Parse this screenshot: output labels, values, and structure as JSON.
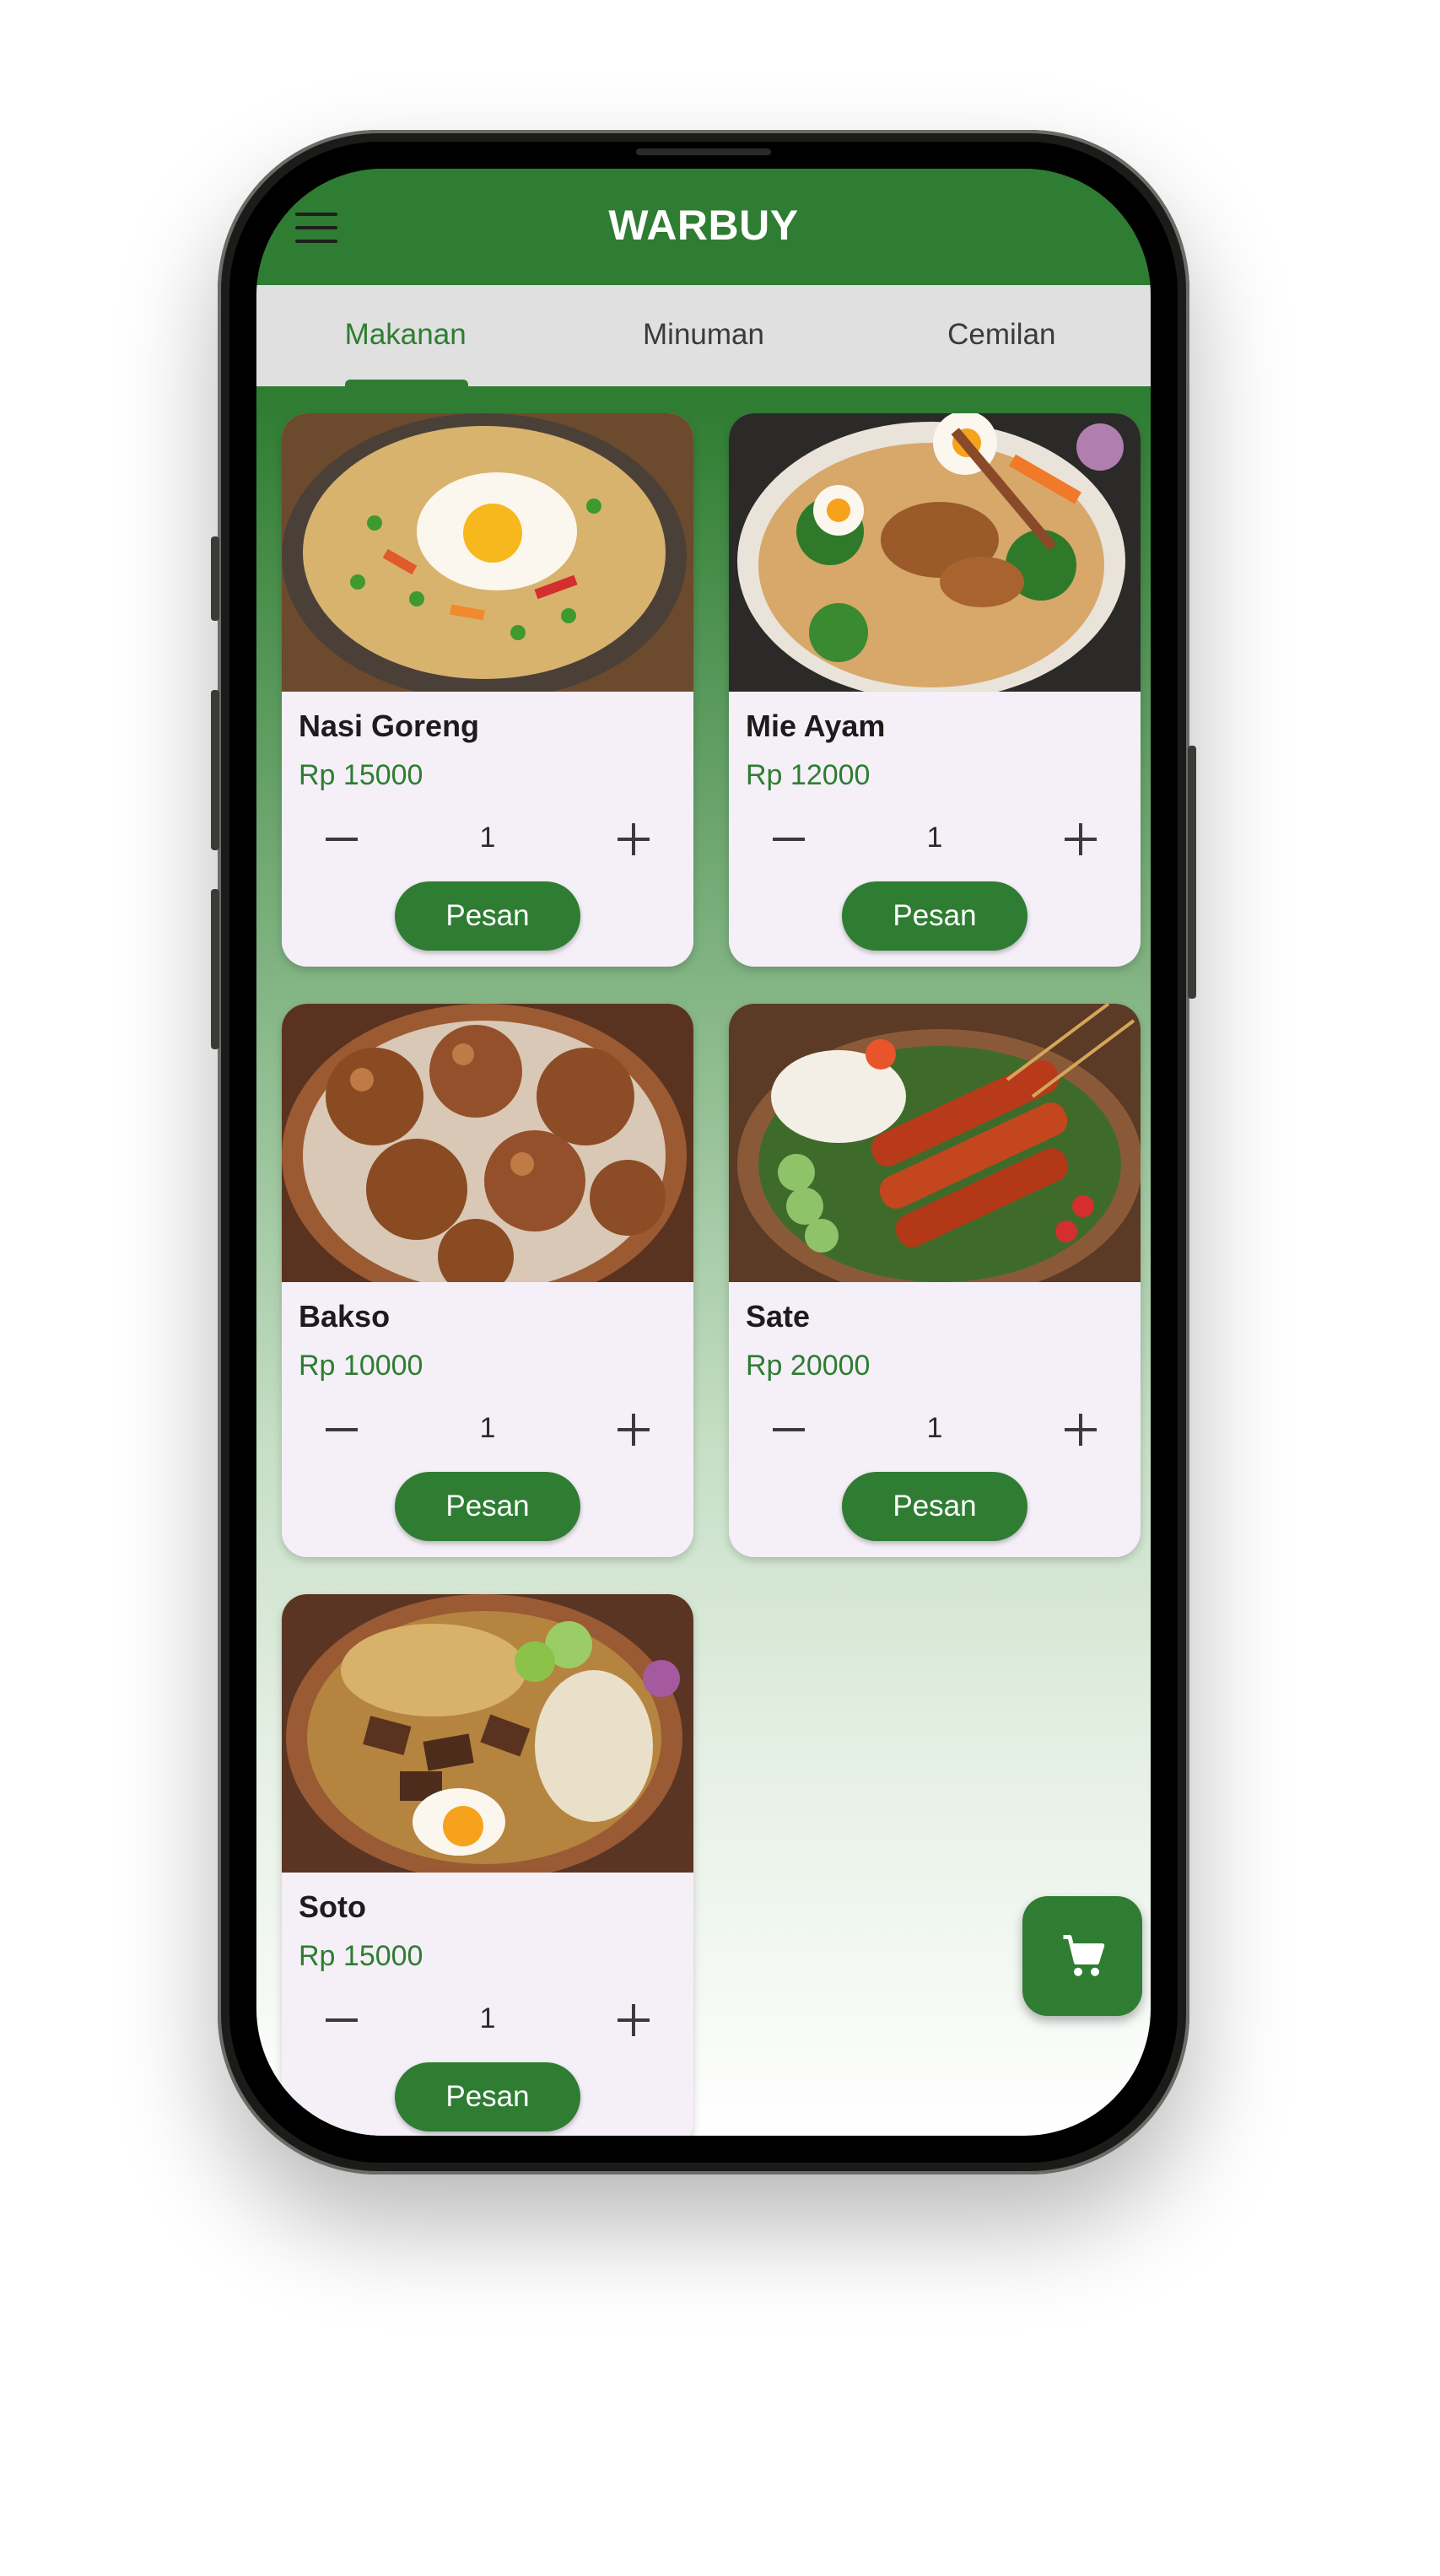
{
  "app": {
    "title": "WARBUY"
  },
  "tabs": [
    {
      "label": "Makanan"
    },
    {
      "label": "Minuman"
    },
    {
      "label": "Cemilan"
    }
  ],
  "active_tab": "Makanan",
  "menu_items": [
    {
      "name": "Nasi Goreng",
      "price": "Rp 15000",
      "quantity": "1",
      "order_label": "Pesan",
      "image": "fried-rice-photo"
    },
    {
      "name": "Mie Ayam",
      "price": "Rp 12000",
      "quantity": "1",
      "order_label": "Pesan",
      "image": "chicken-noodle-photo"
    },
    {
      "name": "Bakso",
      "price": "Rp 10000",
      "quantity": "1",
      "order_label": "Pesan",
      "image": "meatball-photo"
    },
    {
      "name": "Sate",
      "price": "Rp 20000",
      "quantity": "1",
      "order_label": "Pesan",
      "image": "satay-photo"
    },
    {
      "name": "Soto",
      "price": "Rp 15000",
      "quantity": "1",
      "order_label": "Pesan",
      "image": "soto-photo"
    }
  ],
  "icons": {
    "menu": "hamburger-menu-icon",
    "cart": "shopping-cart-icon",
    "decrease": "minus-icon",
    "increase": "plus-icon"
  },
  "colors": {
    "primary": "#2e7d32",
    "tab_bar": "#e0e0e0",
    "card": "#f5eff7"
  }
}
